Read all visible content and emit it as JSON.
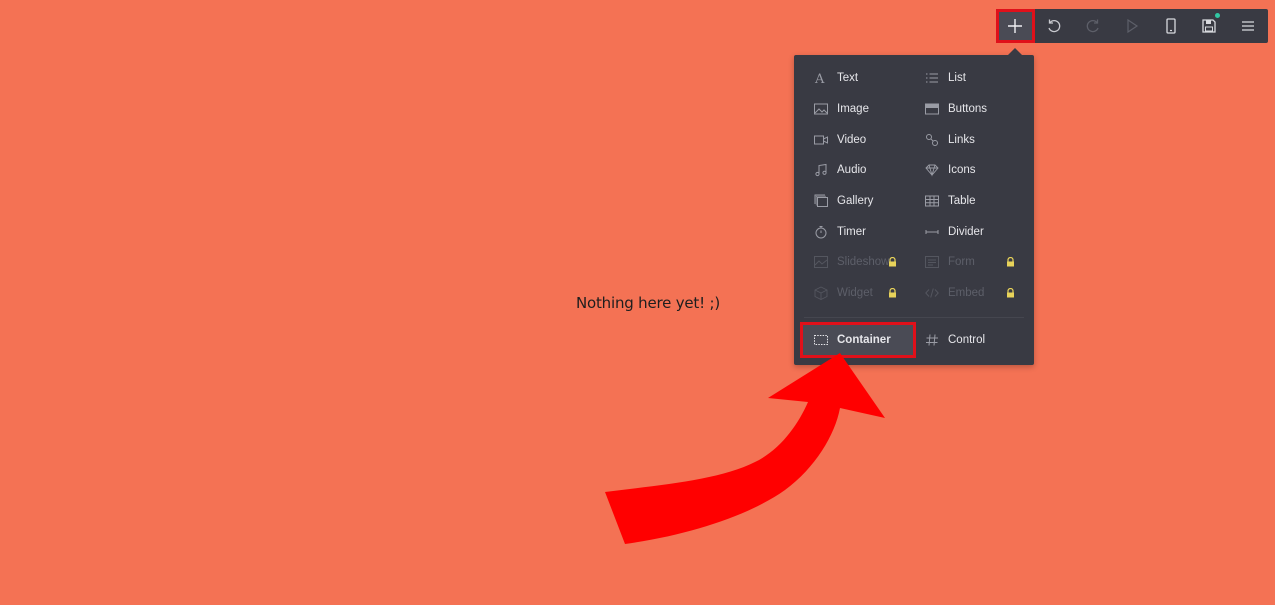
{
  "canvas": {
    "empty_message": "Nothing here yet! ;)"
  },
  "toolbar": {
    "buttons": [
      {
        "name": "add",
        "icon": "plus-icon"
      },
      {
        "name": "undo",
        "icon": "undo-icon"
      },
      {
        "name": "redo",
        "icon": "redo-icon"
      },
      {
        "name": "preview",
        "icon": "play-icon"
      },
      {
        "name": "mobile-view",
        "icon": "phone-icon"
      },
      {
        "name": "save",
        "icon": "floppy-icon"
      },
      {
        "name": "menu",
        "icon": "hamburger-icon"
      }
    ],
    "save_status_color": "#31c7a3"
  },
  "add_menu": {
    "items": [
      {
        "label": "Text",
        "icon": "text-icon",
        "locked": false
      },
      {
        "label": "List",
        "icon": "list-icon",
        "locked": false
      },
      {
        "label": "Image",
        "icon": "image-icon",
        "locked": false
      },
      {
        "label": "Buttons",
        "icon": "buttons-icon",
        "locked": false
      },
      {
        "label": "Video",
        "icon": "video-icon",
        "locked": false
      },
      {
        "label": "Links",
        "icon": "link-icon",
        "locked": false
      },
      {
        "label": "Audio",
        "icon": "music-icon",
        "locked": false
      },
      {
        "label": "Icons",
        "icon": "diamond-icon",
        "locked": false
      },
      {
        "label": "Gallery",
        "icon": "gallery-icon",
        "locked": false
      },
      {
        "label": "Table",
        "icon": "table-icon",
        "locked": false
      },
      {
        "label": "Timer",
        "icon": "stopwatch-icon",
        "locked": false
      },
      {
        "label": "Divider",
        "icon": "divider-icon",
        "locked": false
      },
      {
        "label": "Slideshow",
        "icon": "slideshow-icon",
        "locked": true
      },
      {
        "label": "Form",
        "icon": "form-icon",
        "locked": true
      },
      {
        "label": "Widget",
        "icon": "cube-icon",
        "locked": true
      },
      {
        "label": "Embed",
        "icon": "code-icon",
        "locked": true
      }
    ],
    "bottom_items": [
      {
        "label": "Container",
        "icon": "container-icon",
        "highlighted": true
      },
      {
        "label": "Control",
        "icon": "hash-icon",
        "highlighted": false
      }
    ],
    "lock_color": "#e8d35a"
  },
  "annotation": {
    "highlight_color": "#e0101a",
    "arrow_color": "#ff0000"
  }
}
